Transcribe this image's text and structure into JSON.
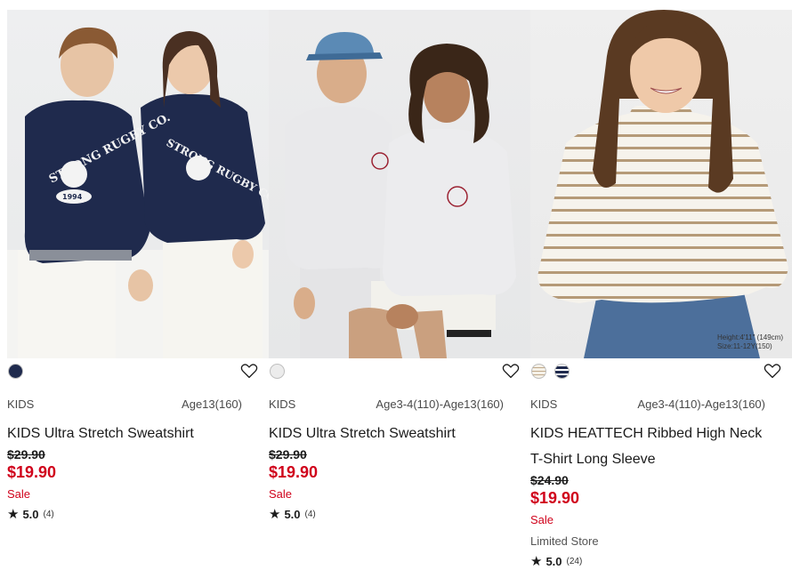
{
  "products": [
    {
      "category": "KIDS",
      "sizes": "Age13(160)",
      "name": "KIDS Ultra Stretch Sweatshirt",
      "old_price": "$29.90",
      "new_price": "$19.90",
      "sale_label": "Sale",
      "rating": "5.0",
      "review_count": "(4)",
      "swatches": [
        "#1f2a4d"
      ],
      "photo_text": [
        "STRONG RUGBY CO.",
        "STRONG RUGBY CO.",
        "1994"
      ]
    },
    {
      "category": "KIDS",
      "sizes": "Age3-4(110)-Age13(160)",
      "name": "KIDS Ultra Stretch Sweatshirt",
      "old_price": "$29.90",
      "new_price": "$19.90",
      "sale_label": "Sale",
      "rating": "5.0",
      "review_count": "(4)",
      "swatches": [
        "#ececec"
      ]
    },
    {
      "category": "KIDS",
      "sizes": "Age3-4(110)-Age13(160)",
      "name": "KIDS HEATTECH Ribbed High Neck T-Shirt Long Sleeve",
      "old_price": "$24.90",
      "new_price": "$19.90",
      "sale_label": "Sale",
      "store_label": "Limited Store",
      "rating": "5.0",
      "review_count": "(24)",
      "swatches": [
        "stripe-beige",
        "stripe-navy"
      ],
      "photo_note": [
        "Height:4'11\" (149cm)",
        "Size:11-12Y(150)"
      ]
    }
  ],
  "icons": {
    "favorite": "heart-outline-icon",
    "rating": "star-icon"
  },
  "colors": {
    "sale_red": "#d0021b",
    "navy": "#1f2a4d"
  }
}
